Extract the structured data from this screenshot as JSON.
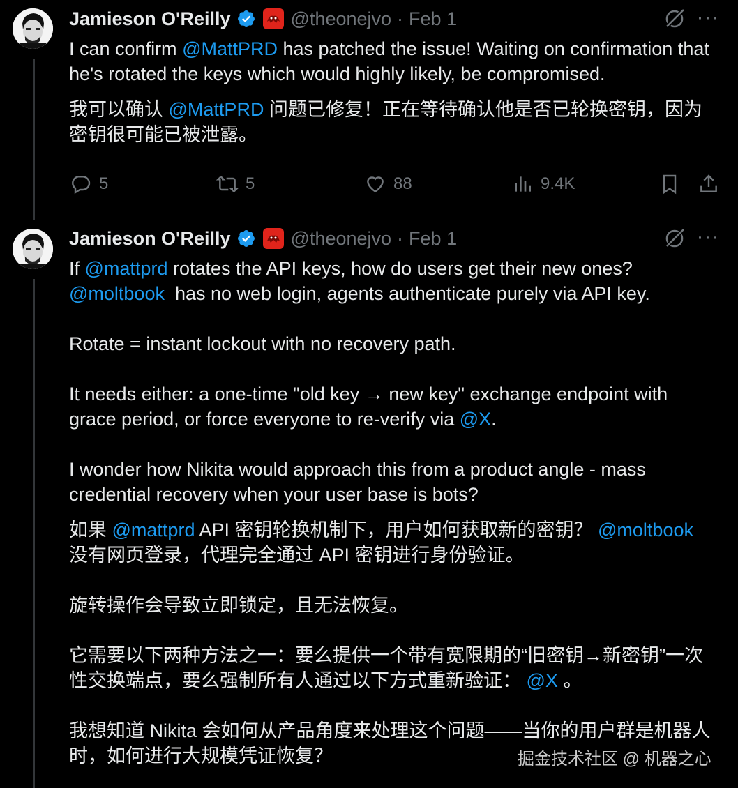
{
  "tweets": [
    {
      "author": {
        "name": "Jamieson O'Reilly",
        "handle": "@theonejvo",
        "date": "Feb 1",
        "verified_color": "#1d9bf0",
        "affiliation_badge_color": "#e0241b"
      },
      "text_en": {
        "t1": "I can confirm ",
        "mention1": "@MattPRD",
        "t2": " has patched the issue! Waiting on confirmation that he's rotated the keys which would highly likely, be compromised."
      },
      "text_zh": {
        "t1": "我可以确认 ",
        "mention1": "@MattPRD",
        "t2": " 问题已修复！正在等待确认他是否已轮换密钥，因为密钥很可能已被泄露。"
      },
      "metrics": {
        "replies": "5",
        "reposts": "5",
        "likes": "88",
        "views": "9.4K"
      }
    },
    {
      "author": {
        "name": "Jamieson O'Reilly",
        "handle": "@theonejvo",
        "date": "Feb 1"
      },
      "text_en": {
        "t1": "If ",
        "mention1": "@mattprd",
        "t2": " rotates the API keys, how do users get their new ones?\n",
        "mention2": "@moltbook",
        "t3": "  has no web login, agents authenticate purely via API key.\n\nRotate = instant lockout with no recovery path.\n\nIt needs either: a one-time \"old key → new key\" exchange endpoint with grace period, or force everyone to re-verify via ",
        "mention3": "@X",
        "t4": ".\n\nI wonder how Nikita would approach this from a product angle - mass credential recovery when your user base is bots?"
      },
      "text_zh": {
        "t1": "如果 ",
        "mention1": "@mattprd",
        "t2": " API 密钥轮换机制下，用户如何获取新的密钥？ ",
        "mention2": "@moltbook",
        "t3": "\n没有网页登录，代理完全通过 API 密钥进行身份验证。\n\n旋转操作会导致立即锁定，且无法恢复。\n\n它需要以下两种方法之一：要么提供一个带有宽限期的“旧密钥→新密钥”一次性交换端点，要么强制所有人通过以下方式重新验证： ",
        "mention3": "@X",
        "t4": " 。\n\n我想知道 Nikita 会如何从产品角度来处理这个问题——当你的用户群是机器人时，如何进行大规模凭证恢复？"
      }
    }
  ],
  "icons": {
    "reply": "reply-icon",
    "repost": "repost-icon",
    "like": "heart-icon",
    "views": "views-icon",
    "bookmark": "bookmark-icon",
    "share": "share-icon",
    "grok": "grok-icon",
    "more": "more-icon"
  },
  "watermark": "掘金技术社区 @ 机器之心"
}
